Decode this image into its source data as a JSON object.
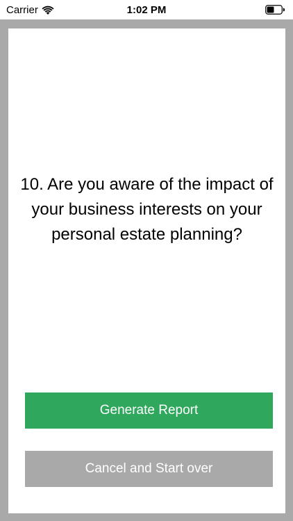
{
  "status_bar": {
    "carrier": "Carrier",
    "time": "1:02 PM",
    "icons": [
      "wifi-icon",
      "battery-icon"
    ]
  },
  "question": {
    "text": "10. Are you aware of the impact of your business interests on your personal estate planning?"
  },
  "buttons": {
    "generate_label": "Generate Report",
    "cancel_label": "Cancel and Start over"
  },
  "colors": {
    "generate_bg": "#2fa75d",
    "cancel_bg": "#a9a9a9",
    "frame_bg": "#a9a9a9"
  }
}
